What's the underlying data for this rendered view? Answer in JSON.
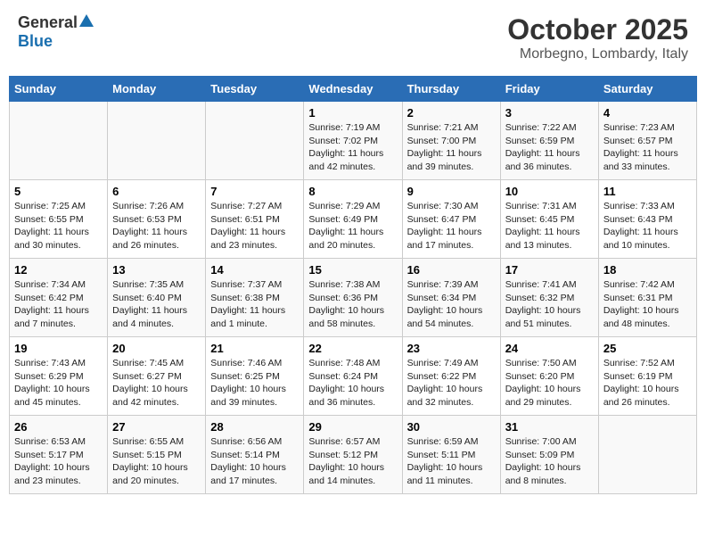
{
  "header": {
    "logo_general": "General",
    "logo_blue": "Blue",
    "month": "October 2025",
    "location": "Morbegno, Lombardy, Italy"
  },
  "days_of_week": [
    "Sunday",
    "Monday",
    "Tuesday",
    "Wednesday",
    "Thursday",
    "Friday",
    "Saturday"
  ],
  "weeks": [
    [
      {
        "day": "",
        "info": ""
      },
      {
        "day": "",
        "info": ""
      },
      {
        "day": "",
        "info": ""
      },
      {
        "day": "1",
        "info": "Sunrise: 7:19 AM\nSunset: 7:02 PM\nDaylight: 11 hours and 42 minutes."
      },
      {
        "day": "2",
        "info": "Sunrise: 7:21 AM\nSunset: 7:00 PM\nDaylight: 11 hours and 39 minutes."
      },
      {
        "day": "3",
        "info": "Sunrise: 7:22 AM\nSunset: 6:59 PM\nDaylight: 11 hours and 36 minutes."
      },
      {
        "day": "4",
        "info": "Sunrise: 7:23 AM\nSunset: 6:57 PM\nDaylight: 11 hours and 33 minutes."
      }
    ],
    [
      {
        "day": "5",
        "info": "Sunrise: 7:25 AM\nSunset: 6:55 PM\nDaylight: 11 hours and 30 minutes."
      },
      {
        "day": "6",
        "info": "Sunrise: 7:26 AM\nSunset: 6:53 PM\nDaylight: 11 hours and 26 minutes."
      },
      {
        "day": "7",
        "info": "Sunrise: 7:27 AM\nSunset: 6:51 PM\nDaylight: 11 hours and 23 minutes."
      },
      {
        "day": "8",
        "info": "Sunrise: 7:29 AM\nSunset: 6:49 PM\nDaylight: 11 hours and 20 minutes."
      },
      {
        "day": "9",
        "info": "Sunrise: 7:30 AM\nSunset: 6:47 PM\nDaylight: 11 hours and 17 minutes."
      },
      {
        "day": "10",
        "info": "Sunrise: 7:31 AM\nSunset: 6:45 PM\nDaylight: 11 hours and 13 minutes."
      },
      {
        "day": "11",
        "info": "Sunrise: 7:33 AM\nSunset: 6:43 PM\nDaylight: 11 hours and 10 minutes."
      }
    ],
    [
      {
        "day": "12",
        "info": "Sunrise: 7:34 AM\nSunset: 6:42 PM\nDaylight: 11 hours and 7 minutes."
      },
      {
        "day": "13",
        "info": "Sunrise: 7:35 AM\nSunset: 6:40 PM\nDaylight: 11 hours and 4 minutes."
      },
      {
        "day": "14",
        "info": "Sunrise: 7:37 AM\nSunset: 6:38 PM\nDaylight: 11 hours and 1 minute."
      },
      {
        "day": "15",
        "info": "Sunrise: 7:38 AM\nSunset: 6:36 PM\nDaylight: 10 hours and 58 minutes."
      },
      {
        "day": "16",
        "info": "Sunrise: 7:39 AM\nSunset: 6:34 PM\nDaylight: 10 hours and 54 minutes."
      },
      {
        "day": "17",
        "info": "Sunrise: 7:41 AM\nSunset: 6:32 PM\nDaylight: 10 hours and 51 minutes."
      },
      {
        "day": "18",
        "info": "Sunrise: 7:42 AM\nSunset: 6:31 PM\nDaylight: 10 hours and 48 minutes."
      }
    ],
    [
      {
        "day": "19",
        "info": "Sunrise: 7:43 AM\nSunset: 6:29 PM\nDaylight: 10 hours and 45 minutes."
      },
      {
        "day": "20",
        "info": "Sunrise: 7:45 AM\nSunset: 6:27 PM\nDaylight: 10 hours and 42 minutes."
      },
      {
        "day": "21",
        "info": "Sunrise: 7:46 AM\nSunset: 6:25 PM\nDaylight: 10 hours and 39 minutes."
      },
      {
        "day": "22",
        "info": "Sunrise: 7:48 AM\nSunset: 6:24 PM\nDaylight: 10 hours and 36 minutes."
      },
      {
        "day": "23",
        "info": "Sunrise: 7:49 AM\nSunset: 6:22 PM\nDaylight: 10 hours and 32 minutes."
      },
      {
        "day": "24",
        "info": "Sunrise: 7:50 AM\nSunset: 6:20 PM\nDaylight: 10 hours and 29 minutes."
      },
      {
        "day": "25",
        "info": "Sunrise: 7:52 AM\nSunset: 6:19 PM\nDaylight: 10 hours and 26 minutes."
      }
    ],
    [
      {
        "day": "26",
        "info": "Sunrise: 6:53 AM\nSunset: 5:17 PM\nDaylight: 10 hours and 23 minutes."
      },
      {
        "day": "27",
        "info": "Sunrise: 6:55 AM\nSunset: 5:15 PM\nDaylight: 10 hours and 20 minutes."
      },
      {
        "day": "28",
        "info": "Sunrise: 6:56 AM\nSunset: 5:14 PM\nDaylight: 10 hours and 17 minutes."
      },
      {
        "day": "29",
        "info": "Sunrise: 6:57 AM\nSunset: 5:12 PM\nDaylight: 10 hours and 14 minutes."
      },
      {
        "day": "30",
        "info": "Sunrise: 6:59 AM\nSunset: 5:11 PM\nDaylight: 10 hours and 11 minutes."
      },
      {
        "day": "31",
        "info": "Sunrise: 7:00 AM\nSunset: 5:09 PM\nDaylight: 10 hours and 8 minutes."
      },
      {
        "day": "",
        "info": ""
      }
    ]
  ]
}
